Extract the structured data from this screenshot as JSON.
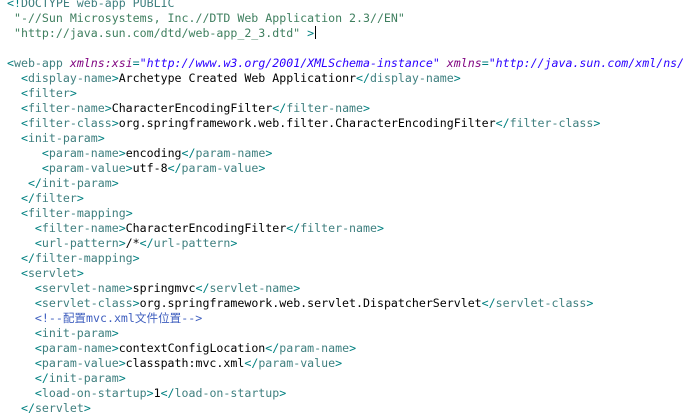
{
  "editor": {
    "colors": {
      "punct": "#008080",
      "tag": "#3f7f7f",
      "attr": "#7f007f",
      "value": "#2a00ff",
      "text": "#000000",
      "comment": "#3f5fbf",
      "doctype": "#3f7f7f",
      "pubid": "#3f7f5f"
    },
    "lines": [
      {
        "indent": "",
        "tokens": [
          [
            "punct",
            "<!"
          ],
          [
            "doctype",
            "DOCTYPE web-app PUBLIC"
          ]
        ]
      },
      {
        "indent": " ",
        "tokens": [
          [
            "pubid",
            "\"-//Sun Microsystems, Inc.//DTD Web Application 2.3//EN\""
          ]
        ]
      },
      {
        "indent": " ",
        "tokens": [
          [
            "pubid",
            "\"http://java.sun.com/dtd/web-app_2_3.dtd\""
          ],
          [
            "text",
            " "
          ],
          [
            "punct",
            ">"
          ]
        ],
        "cursor": true
      },
      {
        "indent": "",
        "tokens": []
      },
      {
        "indent": "",
        "tokens": [
          [
            "punct",
            "<"
          ],
          [
            "tag",
            "web-app"
          ],
          [
            "text",
            " "
          ],
          [
            "attr",
            "xmlns:xsi"
          ],
          [
            "punct",
            "="
          ],
          [
            "value",
            "\"http://www.w3.org/2001/XMLSchema-instance\""
          ],
          [
            "text",
            " "
          ],
          [
            "attr",
            "xmlns"
          ],
          [
            "punct",
            "="
          ],
          [
            "value",
            "\"http://java.sun.com/xml/ns/"
          ]
        ]
      },
      {
        "indent": "  ",
        "tokens": [
          [
            "punct",
            "<"
          ],
          [
            "tag",
            "display-name"
          ],
          [
            "punct",
            ">"
          ],
          [
            "text",
            "Archetype Created Web Applicationr"
          ],
          [
            "punct",
            "</"
          ],
          [
            "tag",
            "display-name"
          ],
          [
            "punct",
            ">"
          ]
        ]
      },
      {
        "indent": "  ",
        "tokens": [
          [
            "punct",
            "<"
          ],
          [
            "tag",
            "filter"
          ],
          [
            "punct",
            ">"
          ]
        ]
      },
      {
        "indent": "  ",
        "tokens": [
          [
            "punct",
            "<"
          ],
          [
            "tag",
            "filter-name"
          ],
          [
            "punct",
            ">"
          ],
          [
            "text",
            "CharacterEncodingFilter"
          ],
          [
            "punct",
            "</"
          ],
          [
            "tag",
            "filter-name"
          ],
          [
            "punct",
            ">"
          ]
        ]
      },
      {
        "indent": "  ",
        "tokens": [
          [
            "punct",
            "<"
          ],
          [
            "tag",
            "filter-class"
          ],
          [
            "punct",
            ">"
          ],
          [
            "text",
            "org.springframework.web.filter.CharacterEncodingFilter"
          ],
          [
            "punct",
            "</"
          ],
          [
            "tag",
            "filter-class"
          ],
          [
            "punct",
            ">"
          ]
        ]
      },
      {
        "indent": "  ",
        "tokens": [
          [
            "punct",
            "<"
          ],
          [
            "tag",
            "init-param"
          ],
          [
            "punct",
            ">"
          ]
        ]
      },
      {
        "indent": "     ",
        "tokens": [
          [
            "punct",
            "<"
          ],
          [
            "tag",
            "param-name"
          ],
          [
            "punct",
            ">"
          ],
          [
            "text",
            "encoding"
          ],
          [
            "punct",
            "</"
          ],
          [
            "tag",
            "param-name"
          ],
          [
            "punct",
            ">"
          ]
        ]
      },
      {
        "indent": "     ",
        "tokens": [
          [
            "punct",
            "<"
          ],
          [
            "tag",
            "param-value"
          ],
          [
            "punct",
            ">"
          ],
          [
            "text",
            "utf-8"
          ],
          [
            "punct",
            "</"
          ],
          [
            "tag",
            "param-value"
          ],
          [
            "punct",
            ">"
          ]
        ]
      },
      {
        "indent": "   ",
        "tokens": [
          [
            "punct",
            "</"
          ],
          [
            "tag",
            "init-param"
          ],
          [
            "punct",
            ">"
          ]
        ]
      },
      {
        "indent": "  ",
        "tokens": [
          [
            "punct",
            "</"
          ],
          [
            "tag",
            "filter"
          ],
          [
            "punct",
            ">"
          ]
        ]
      },
      {
        "indent": "  ",
        "tokens": [
          [
            "punct",
            "<"
          ],
          [
            "tag",
            "filter-mapping"
          ],
          [
            "punct",
            ">"
          ]
        ]
      },
      {
        "indent": "    ",
        "tokens": [
          [
            "punct",
            "<"
          ],
          [
            "tag",
            "filter-name"
          ],
          [
            "punct",
            ">"
          ],
          [
            "text",
            "CharacterEncodingFilter"
          ],
          [
            "punct",
            "</"
          ],
          [
            "tag",
            "filter-name"
          ],
          [
            "punct",
            ">"
          ]
        ]
      },
      {
        "indent": "    ",
        "tokens": [
          [
            "punct",
            "<"
          ],
          [
            "tag",
            "url-pattern"
          ],
          [
            "punct",
            ">"
          ],
          [
            "text",
            "/*"
          ],
          [
            "punct",
            "</"
          ],
          [
            "tag",
            "url-pattern"
          ],
          [
            "punct",
            ">"
          ]
        ]
      },
      {
        "indent": "  ",
        "tokens": [
          [
            "punct",
            "</"
          ],
          [
            "tag",
            "filter-mapping"
          ],
          [
            "punct",
            ">"
          ]
        ]
      },
      {
        "indent": "  ",
        "tokens": [
          [
            "punct",
            "<"
          ],
          [
            "tag",
            "servlet"
          ],
          [
            "punct",
            ">"
          ]
        ]
      },
      {
        "indent": "    ",
        "tokens": [
          [
            "punct",
            "<"
          ],
          [
            "tag",
            "servlet-name"
          ],
          [
            "punct",
            ">"
          ],
          [
            "text",
            "springmvc"
          ],
          [
            "punct",
            "</"
          ],
          [
            "tag",
            "servlet-name"
          ],
          [
            "punct",
            ">"
          ]
        ]
      },
      {
        "indent": "    ",
        "tokens": [
          [
            "punct",
            "<"
          ],
          [
            "tag",
            "servlet-class"
          ],
          [
            "punct",
            ">"
          ],
          [
            "text",
            "org.springframework.web.servlet.DispatcherServlet"
          ],
          [
            "punct",
            "</"
          ],
          [
            "tag",
            "servlet-class"
          ],
          [
            "punct",
            ">"
          ]
        ]
      },
      {
        "indent": "    ",
        "tokens": [
          [
            "comment",
            "<!--配置mvc.xml文件位置-->"
          ]
        ]
      },
      {
        "indent": "    ",
        "tokens": [
          [
            "punct",
            "<"
          ],
          [
            "tag",
            "init-param"
          ],
          [
            "punct",
            ">"
          ]
        ]
      },
      {
        "indent": "    ",
        "tokens": [
          [
            "punct",
            "<"
          ],
          [
            "tag",
            "param-name"
          ],
          [
            "punct",
            ">"
          ],
          [
            "text",
            "contextConfigLocation"
          ],
          [
            "punct",
            "</"
          ],
          [
            "tag",
            "param-name"
          ],
          [
            "punct",
            ">"
          ]
        ]
      },
      {
        "indent": "    ",
        "tokens": [
          [
            "punct",
            "<"
          ],
          [
            "tag",
            "param-value"
          ],
          [
            "punct",
            ">"
          ],
          [
            "text",
            "classpath:mvc.xml"
          ],
          [
            "punct",
            "</"
          ],
          [
            "tag",
            "param-value"
          ],
          [
            "punct",
            ">"
          ]
        ]
      },
      {
        "indent": "    ",
        "tokens": [
          [
            "punct",
            "</"
          ],
          [
            "tag",
            "init-param"
          ],
          [
            "punct",
            ">"
          ]
        ]
      },
      {
        "indent": "    ",
        "tokens": [
          [
            "punct",
            "<"
          ],
          [
            "tag",
            "load-on-startup"
          ],
          [
            "punct",
            ">"
          ],
          [
            "text",
            "1"
          ],
          [
            "punct",
            "</"
          ],
          [
            "tag",
            "load-on-startup"
          ],
          [
            "punct",
            ">"
          ]
        ]
      },
      {
        "indent": "  ",
        "tokens": [
          [
            "punct",
            "</"
          ],
          [
            "tag",
            "servlet"
          ],
          [
            "punct",
            ">"
          ]
        ]
      }
    ]
  }
}
